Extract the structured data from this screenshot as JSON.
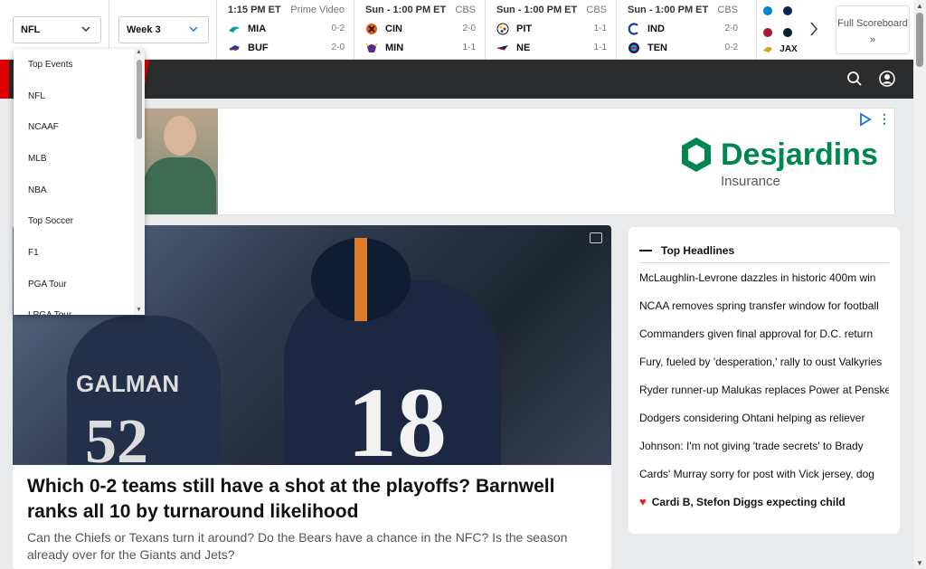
{
  "scoreboard": {
    "league_select": "NFL",
    "week_select": "Week 3",
    "games": [
      {
        "time": "1:15 PM ET",
        "network": "Prime Video",
        "teams": [
          {
            "abbr": "MIA",
            "record": "0-2",
            "color": "#0a9ba3"
          },
          {
            "abbr": "BUF",
            "record": "2-0",
            "color": "#0b3ea6"
          }
        ]
      },
      {
        "time": "Sun - 1:00 PM ET",
        "network": "CBS",
        "teams": [
          {
            "abbr": "CIN",
            "record": "2-0",
            "color": "#e35b14"
          },
          {
            "abbr": "MIN",
            "record": "1-1",
            "color": "#5b2b8c"
          }
        ]
      },
      {
        "time": "Sun - 1:00 PM ET",
        "network": "CBS",
        "teams": [
          {
            "abbr": "PIT",
            "record": "1-1",
            "color": "#f6b900"
          },
          {
            "abbr": "NE",
            "record": "1-1",
            "color": "#0b2551"
          }
        ]
      },
      {
        "time": "Sun - 1:00 PM ET",
        "network": "CBS",
        "teams": [
          {
            "abbr": "IND",
            "record": "2-0",
            "color": "#0f3fa0"
          },
          {
            "abbr": "TEN",
            "record": "0-2",
            "color": "#3e8ce0"
          }
        ]
      }
    ],
    "partial_team": "JAX",
    "full_scoreboard_label": "Full Scoreboard »"
  },
  "dropdown": {
    "items": [
      "Top Events",
      "NFL",
      "NCAAF",
      "MLB",
      "NBA",
      "Top Soccer",
      "F1",
      "PGA Tour",
      "LPGA Tour"
    ]
  },
  "ad": {
    "brand": "Desjardins",
    "sub": "Insurance"
  },
  "lead_story": {
    "title": "Which 0-2 teams still have a shot at the playoffs? Barnwell ranks all 10 by turnaround likelihood",
    "description": "Can the Chiefs or Texans turn it around? Do the Bears have a chance in the NFC? Is the season already over for the Giants and Jets?",
    "jersey_number": "18",
    "bg_jersey_number": "52",
    "bg_name": "GALMAN"
  },
  "headlines": {
    "title": "Top Headlines",
    "items": [
      "McLaughlin-Levrone dazzles in historic 400m win",
      "NCAA removes spring transfer window for football",
      "Commanders given final approval for D.C. return",
      "Fury, fueled by 'desperation,' rally to oust Valkyries",
      "Ryder runner-up Malukas replaces Power at Penske",
      "Dodgers considering Ohtani helping as reliever",
      "Johnson: I'm not giving 'trade secrets' to Brady",
      "Cards' Murray sorry for post with Vick jersey, dog",
      "Cardi B, Stefon Diggs expecting child"
    ]
  }
}
